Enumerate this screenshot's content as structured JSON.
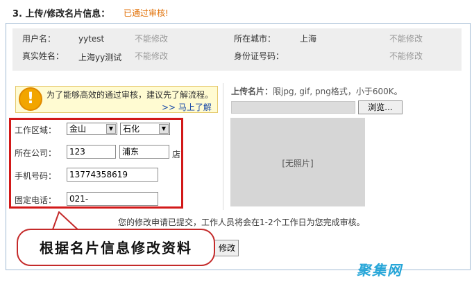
{
  "header": {
    "title": "3. 上传/修改名片信息：",
    "status": "已通过审核!"
  },
  "info": {
    "username_label": "用户名：",
    "username_value": "yytest",
    "username_note": "不能修改",
    "city_label": "所在城市：",
    "city_value": "上海",
    "city_note": "不能修改",
    "realname_label": "真实姓名：",
    "realname_value": "上海yy测试",
    "realname_note": "不能修改",
    "idcard_label": "身份证号码：",
    "idcard_note": "不能修改"
  },
  "notice": {
    "icon": "warning-icon",
    "icon_glyph": "!",
    "text": "为了能够高效的通过审核，建议先了解流程。",
    "link": ">> 马上了解"
  },
  "form": {
    "area_label": "工作区域：",
    "area_select1": "金山",
    "area_select2": "石化",
    "company_label": "所在公司：",
    "company_value": "123",
    "branch_value": "浦东",
    "branch_suffix": "店",
    "mobile_label": "手机号码：",
    "mobile_value": "13774358619",
    "phone_label": "固定电话：",
    "phone_value": "021-"
  },
  "upload": {
    "label": "上传名片：",
    "hint": "限jpg, gif, png格式，小于600K。",
    "browse_label": "浏览...",
    "photo_placeholder": "[无照片]"
  },
  "submit": {
    "note": "您的修改申请已提交，工作人员将会在1-2个工作日为您完成审核。",
    "button_label": "修改"
  },
  "callout": {
    "text": "根据名片信息修改资料"
  },
  "watermark": {
    "text": "聚集网"
  },
  "colors": {
    "status_orange": "#e06d00",
    "highlight_red": "#d21919",
    "panel_border": "#9fb9d3",
    "link_blue": "#1a4aa8"
  }
}
